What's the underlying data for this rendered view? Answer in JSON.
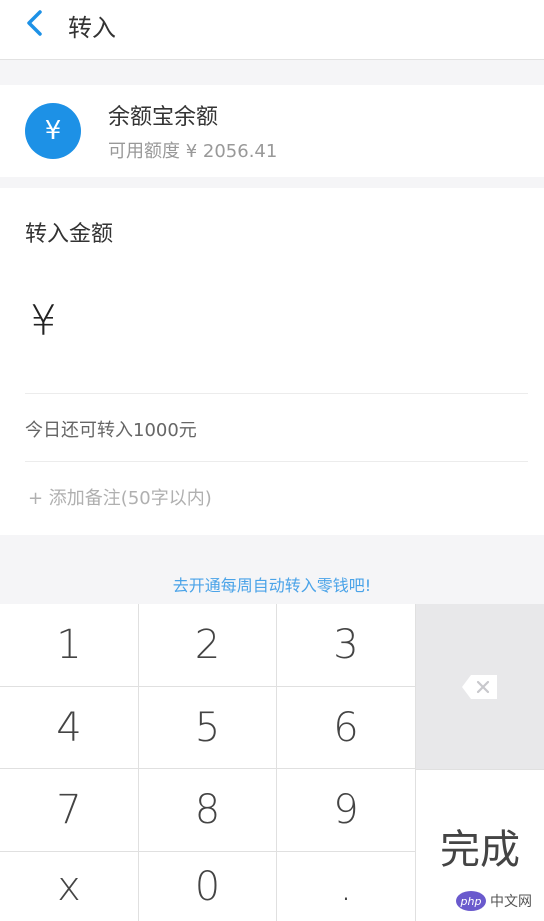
{
  "header": {
    "title": "转入",
    "back_icon": "chevron-left-icon"
  },
  "account": {
    "icon_symbol": "¥",
    "title": "余额宝余额",
    "available": "可用额度 ¥ 2056.41"
  },
  "transfer": {
    "amount_label": "转入金额",
    "currency_symbol": "¥",
    "daily_limit": "今日还可转入1000元",
    "remark_placeholder": "+ 添加备注(50字以内)"
  },
  "promo_link": "去开通每周自动转入零钱吧!",
  "keypad": {
    "keys": [
      "1",
      "2",
      "3",
      "4",
      "5",
      "6",
      "7",
      "8",
      "9",
      "x",
      "0",
      "."
    ],
    "delete_icon": "backspace-icon",
    "done_label": "完成"
  },
  "watermark": {
    "logo": "php",
    "text": "中文网"
  },
  "colors": {
    "accent": "#1d91e6",
    "link": "#4aa3e8",
    "delete_key_bg": "#e8e8ea"
  }
}
